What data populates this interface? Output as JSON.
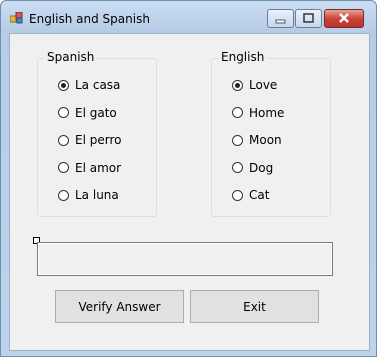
{
  "window": {
    "title": "English and Spanish"
  },
  "spanish": {
    "label": "Spanish",
    "options": [
      "La casa",
      "El gato",
      "El perro",
      "El amor",
      "La luna"
    ],
    "selected_index": 0
  },
  "english": {
    "label": "English",
    "options": [
      "Love",
      "Home",
      "Moon",
      "Dog",
      "Cat"
    ],
    "selected_index": 0
  },
  "answer_box": {
    "value": ""
  },
  "buttons": {
    "verify": "Verify Answer",
    "exit": "Exit"
  }
}
